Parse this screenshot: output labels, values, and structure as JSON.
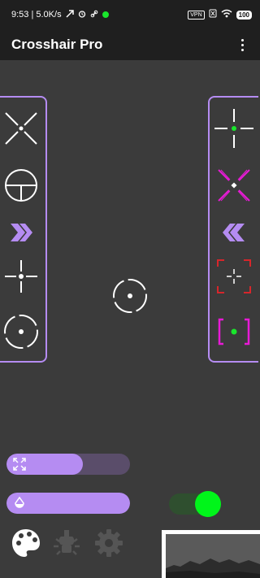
{
  "status_bar": {
    "time_speed": "9:53 | 5.0K/s",
    "vpn": "VPN",
    "battery": "100"
  },
  "app": {
    "title": "Crosshair Pro"
  },
  "left_panel": {
    "items": [
      "x-crosshair-icon",
      "scope-crosshair-icon",
      "next-arrow-icon",
      "gap-cross-crosshair-icon",
      "circle-dot-crosshair-icon"
    ]
  },
  "right_panel": {
    "items": [
      "green-dot-cross-crosshair-icon",
      "magenta-x-crosshair-icon",
      "prev-arrow-icon",
      "red-bracket-crosshair-icon",
      "magenta-bracket-dot-crosshair-icon"
    ]
  },
  "controls": {
    "size_slider": 0.62,
    "opacity_slider": 1.0,
    "toggle_on": true
  },
  "colors": {
    "accent": "#b58cf2",
    "background": "#3b3b3b",
    "bar": "#1f1f1f",
    "toggle_on": "#00f51a",
    "crosshair_green": "#19e62c",
    "crosshair_magenta": "#e81ad6",
    "crosshair_red": "#d6262b"
  }
}
